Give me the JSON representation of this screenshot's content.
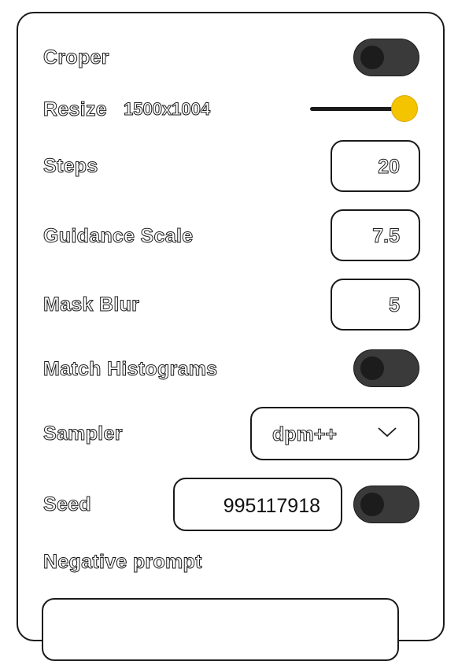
{
  "settings": {
    "cropper": {
      "label": "Croper",
      "enabled": false
    },
    "resize": {
      "label": "Resize",
      "value": "1500x1004",
      "level": 1.0
    },
    "steps": {
      "label": "Steps",
      "value": "20"
    },
    "guidance_scale": {
      "label": "Guidance Scale",
      "value": "7.5"
    },
    "mask_blur": {
      "label": "Mask Blur",
      "value": "5"
    },
    "match_histograms": {
      "label": "Match Histograms",
      "enabled": false
    },
    "sampler": {
      "label": "Sampler",
      "value": "dpm++"
    },
    "seed": {
      "label": "Seed",
      "value": "995117918",
      "random_enabled": false
    },
    "negative_prompt": {
      "label": "Negative prompt",
      "value": ""
    }
  },
  "colors": {
    "slider_thumb": "#f5c400",
    "toggle_off": "#3a3a3a",
    "border": "#1a1a1a"
  },
  "icons": {
    "sampler_dropdown": "chevron-down-icon"
  }
}
